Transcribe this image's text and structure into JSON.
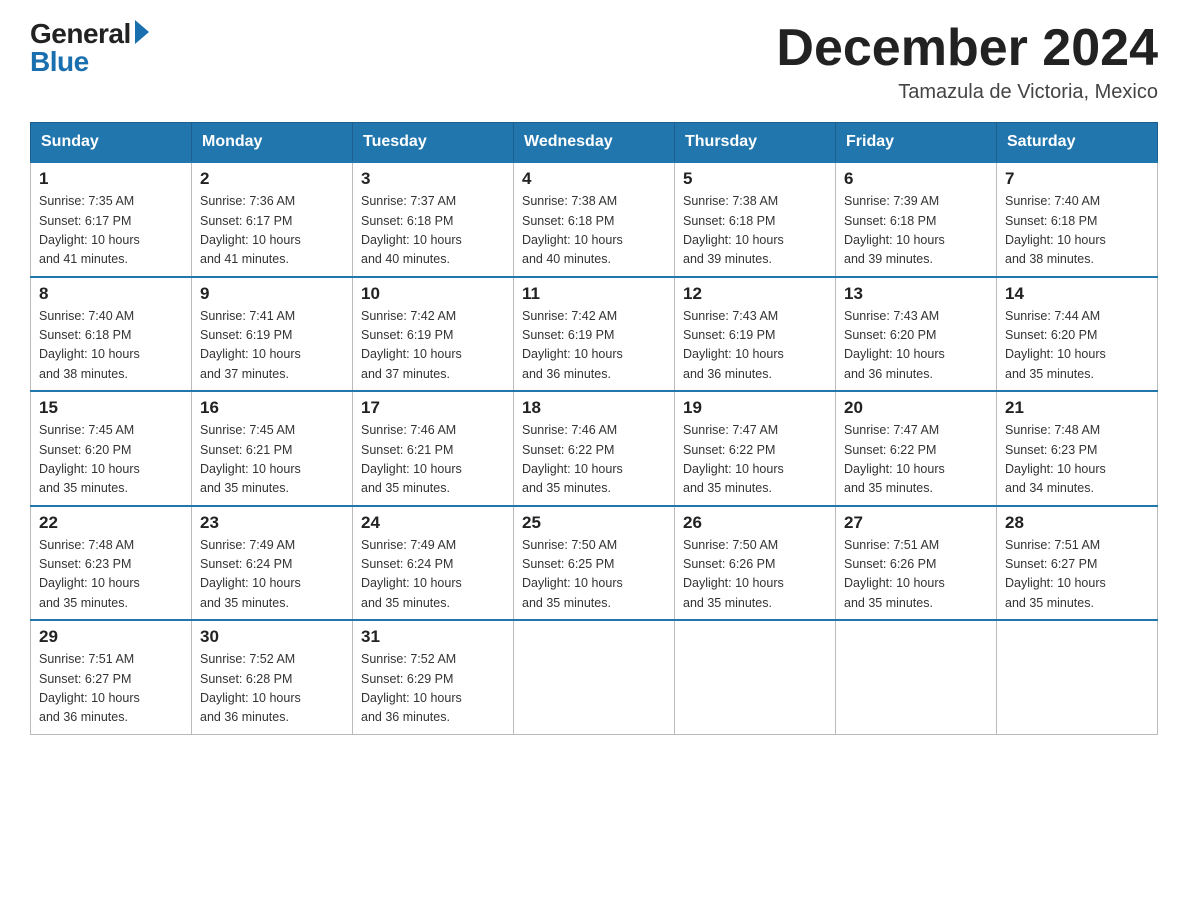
{
  "logo": {
    "general": "General",
    "blue": "Blue",
    "arrow_label": "logo-arrow"
  },
  "title": "December 2024",
  "location": "Tamazula de Victoria, Mexico",
  "days_of_week": [
    "Sunday",
    "Monday",
    "Tuesday",
    "Wednesday",
    "Thursday",
    "Friday",
    "Saturday"
  ],
  "weeks": [
    [
      {
        "day": "1",
        "sunrise": "7:35 AM",
        "sunset": "6:17 PM",
        "daylight": "10 hours and 41 minutes."
      },
      {
        "day": "2",
        "sunrise": "7:36 AM",
        "sunset": "6:17 PM",
        "daylight": "10 hours and 41 minutes."
      },
      {
        "day": "3",
        "sunrise": "7:37 AM",
        "sunset": "6:18 PM",
        "daylight": "10 hours and 40 minutes."
      },
      {
        "day": "4",
        "sunrise": "7:38 AM",
        "sunset": "6:18 PM",
        "daylight": "10 hours and 40 minutes."
      },
      {
        "day": "5",
        "sunrise": "7:38 AM",
        "sunset": "6:18 PM",
        "daylight": "10 hours and 39 minutes."
      },
      {
        "day": "6",
        "sunrise": "7:39 AM",
        "sunset": "6:18 PM",
        "daylight": "10 hours and 39 minutes."
      },
      {
        "day": "7",
        "sunrise": "7:40 AM",
        "sunset": "6:18 PM",
        "daylight": "10 hours and 38 minutes."
      }
    ],
    [
      {
        "day": "8",
        "sunrise": "7:40 AM",
        "sunset": "6:18 PM",
        "daylight": "10 hours and 38 minutes."
      },
      {
        "day": "9",
        "sunrise": "7:41 AM",
        "sunset": "6:19 PM",
        "daylight": "10 hours and 37 minutes."
      },
      {
        "day": "10",
        "sunrise": "7:42 AM",
        "sunset": "6:19 PM",
        "daylight": "10 hours and 37 minutes."
      },
      {
        "day": "11",
        "sunrise": "7:42 AM",
        "sunset": "6:19 PM",
        "daylight": "10 hours and 36 minutes."
      },
      {
        "day": "12",
        "sunrise": "7:43 AM",
        "sunset": "6:19 PM",
        "daylight": "10 hours and 36 minutes."
      },
      {
        "day": "13",
        "sunrise": "7:43 AM",
        "sunset": "6:20 PM",
        "daylight": "10 hours and 36 minutes."
      },
      {
        "day": "14",
        "sunrise": "7:44 AM",
        "sunset": "6:20 PM",
        "daylight": "10 hours and 35 minutes."
      }
    ],
    [
      {
        "day": "15",
        "sunrise": "7:45 AM",
        "sunset": "6:20 PM",
        "daylight": "10 hours and 35 minutes."
      },
      {
        "day": "16",
        "sunrise": "7:45 AM",
        "sunset": "6:21 PM",
        "daylight": "10 hours and 35 minutes."
      },
      {
        "day": "17",
        "sunrise": "7:46 AM",
        "sunset": "6:21 PM",
        "daylight": "10 hours and 35 minutes."
      },
      {
        "day": "18",
        "sunrise": "7:46 AM",
        "sunset": "6:22 PM",
        "daylight": "10 hours and 35 minutes."
      },
      {
        "day": "19",
        "sunrise": "7:47 AM",
        "sunset": "6:22 PM",
        "daylight": "10 hours and 35 minutes."
      },
      {
        "day": "20",
        "sunrise": "7:47 AM",
        "sunset": "6:22 PM",
        "daylight": "10 hours and 35 minutes."
      },
      {
        "day": "21",
        "sunrise": "7:48 AM",
        "sunset": "6:23 PM",
        "daylight": "10 hours and 34 minutes."
      }
    ],
    [
      {
        "day": "22",
        "sunrise": "7:48 AM",
        "sunset": "6:23 PM",
        "daylight": "10 hours and 35 minutes."
      },
      {
        "day": "23",
        "sunrise": "7:49 AM",
        "sunset": "6:24 PM",
        "daylight": "10 hours and 35 minutes."
      },
      {
        "day": "24",
        "sunrise": "7:49 AM",
        "sunset": "6:24 PM",
        "daylight": "10 hours and 35 minutes."
      },
      {
        "day": "25",
        "sunrise": "7:50 AM",
        "sunset": "6:25 PM",
        "daylight": "10 hours and 35 minutes."
      },
      {
        "day": "26",
        "sunrise": "7:50 AM",
        "sunset": "6:26 PM",
        "daylight": "10 hours and 35 minutes."
      },
      {
        "day": "27",
        "sunrise": "7:51 AM",
        "sunset": "6:26 PM",
        "daylight": "10 hours and 35 minutes."
      },
      {
        "day": "28",
        "sunrise": "7:51 AM",
        "sunset": "6:27 PM",
        "daylight": "10 hours and 35 minutes."
      }
    ],
    [
      {
        "day": "29",
        "sunrise": "7:51 AM",
        "sunset": "6:27 PM",
        "daylight": "10 hours and 36 minutes."
      },
      {
        "day": "30",
        "sunrise": "7:52 AM",
        "sunset": "6:28 PM",
        "daylight": "10 hours and 36 minutes."
      },
      {
        "day": "31",
        "sunrise": "7:52 AM",
        "sunset": "6:29 PM",
        "daylight": "10 hours and 36 minutes."
      },
      null,
      null,
      null,
      null
    ]
  ]
}
